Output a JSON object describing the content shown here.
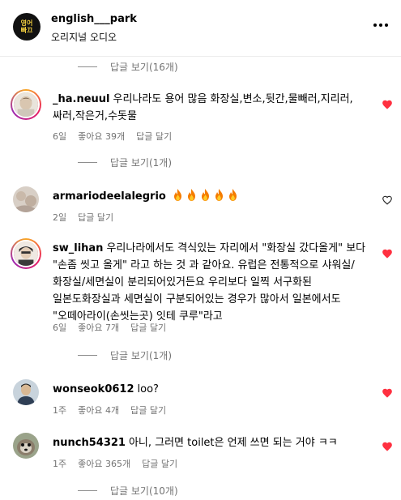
{
  "header": {
    "logo_text": "영어\n빠끄",
    "account": "english___park",
    "subtitle": "오리지널 오디오",
    "more_icon": "more-horizontal-icon"
  },
  "view_replies": [
    "답글 보기(16개)",
    "답글 보기(1개)",
    "답글 보기(1개)",
    "답글 보기(10개)"
  ],
  "comments": [
    {
      "username": "_ha.neuul",
      "text": "우리나라도 용어 많음 화장실,변소,뒷간,물빼러,지리러,싸러,작은거,수돗물",
      "time": "6일",
      "likes": "좋아요 39개",
      "reply": "답글 달기",
      "liked": true
    },
    {
      "username": "armariodeelalegrio",
      "text": "",
      "emoji_count": 5,
      "time": "2일",
      "likes": "",
      "reply": "답글 달기",
      "liked": false
    },
    {
      "username": "sw_lihan",
      "text": "우리나라에서도 격식있는 자리에서 \"화장실 갔다올게\" 보다 \"손좀 씻고 올게\" 라고 하는 것 과 같아요. 유럽은 전통적으로 샤워실/화장실/세면실이 분리되어있거든요 우리보다 일찍 서구화된 일본도화장실과 세면실이 구분되어있는 경우가 많아서 일본에서도 \"오떼아라이(손씻는곳) 잇테 쿠루\"라고",
      "time": "6일",
      "likes": "좋아요 7개",
      "reply": "답글 달기",
      "liked": true
    },
    {
      "username": "wonseok0612",
      "text": "loo?",
      "time": "1주",
      "likes": "좋아요 4개",
      "reply": "답글 달기",
      "liked": true
    },
    {
      "username": "nunch54321",
      "text": "아니, 그러면 toilet은 언제 쓰면 되는 거야 ㅋㅋ",
      "time": "1주",
      "likes": "좋아요 365개",
      "reply": "답글 달기",
      "liked": true
    }
  ],
  "colors": {
    "heart_liked": "#ff3040",
    "muted_text": "#737373",
    "flame": "#f57c00"
  }
}
